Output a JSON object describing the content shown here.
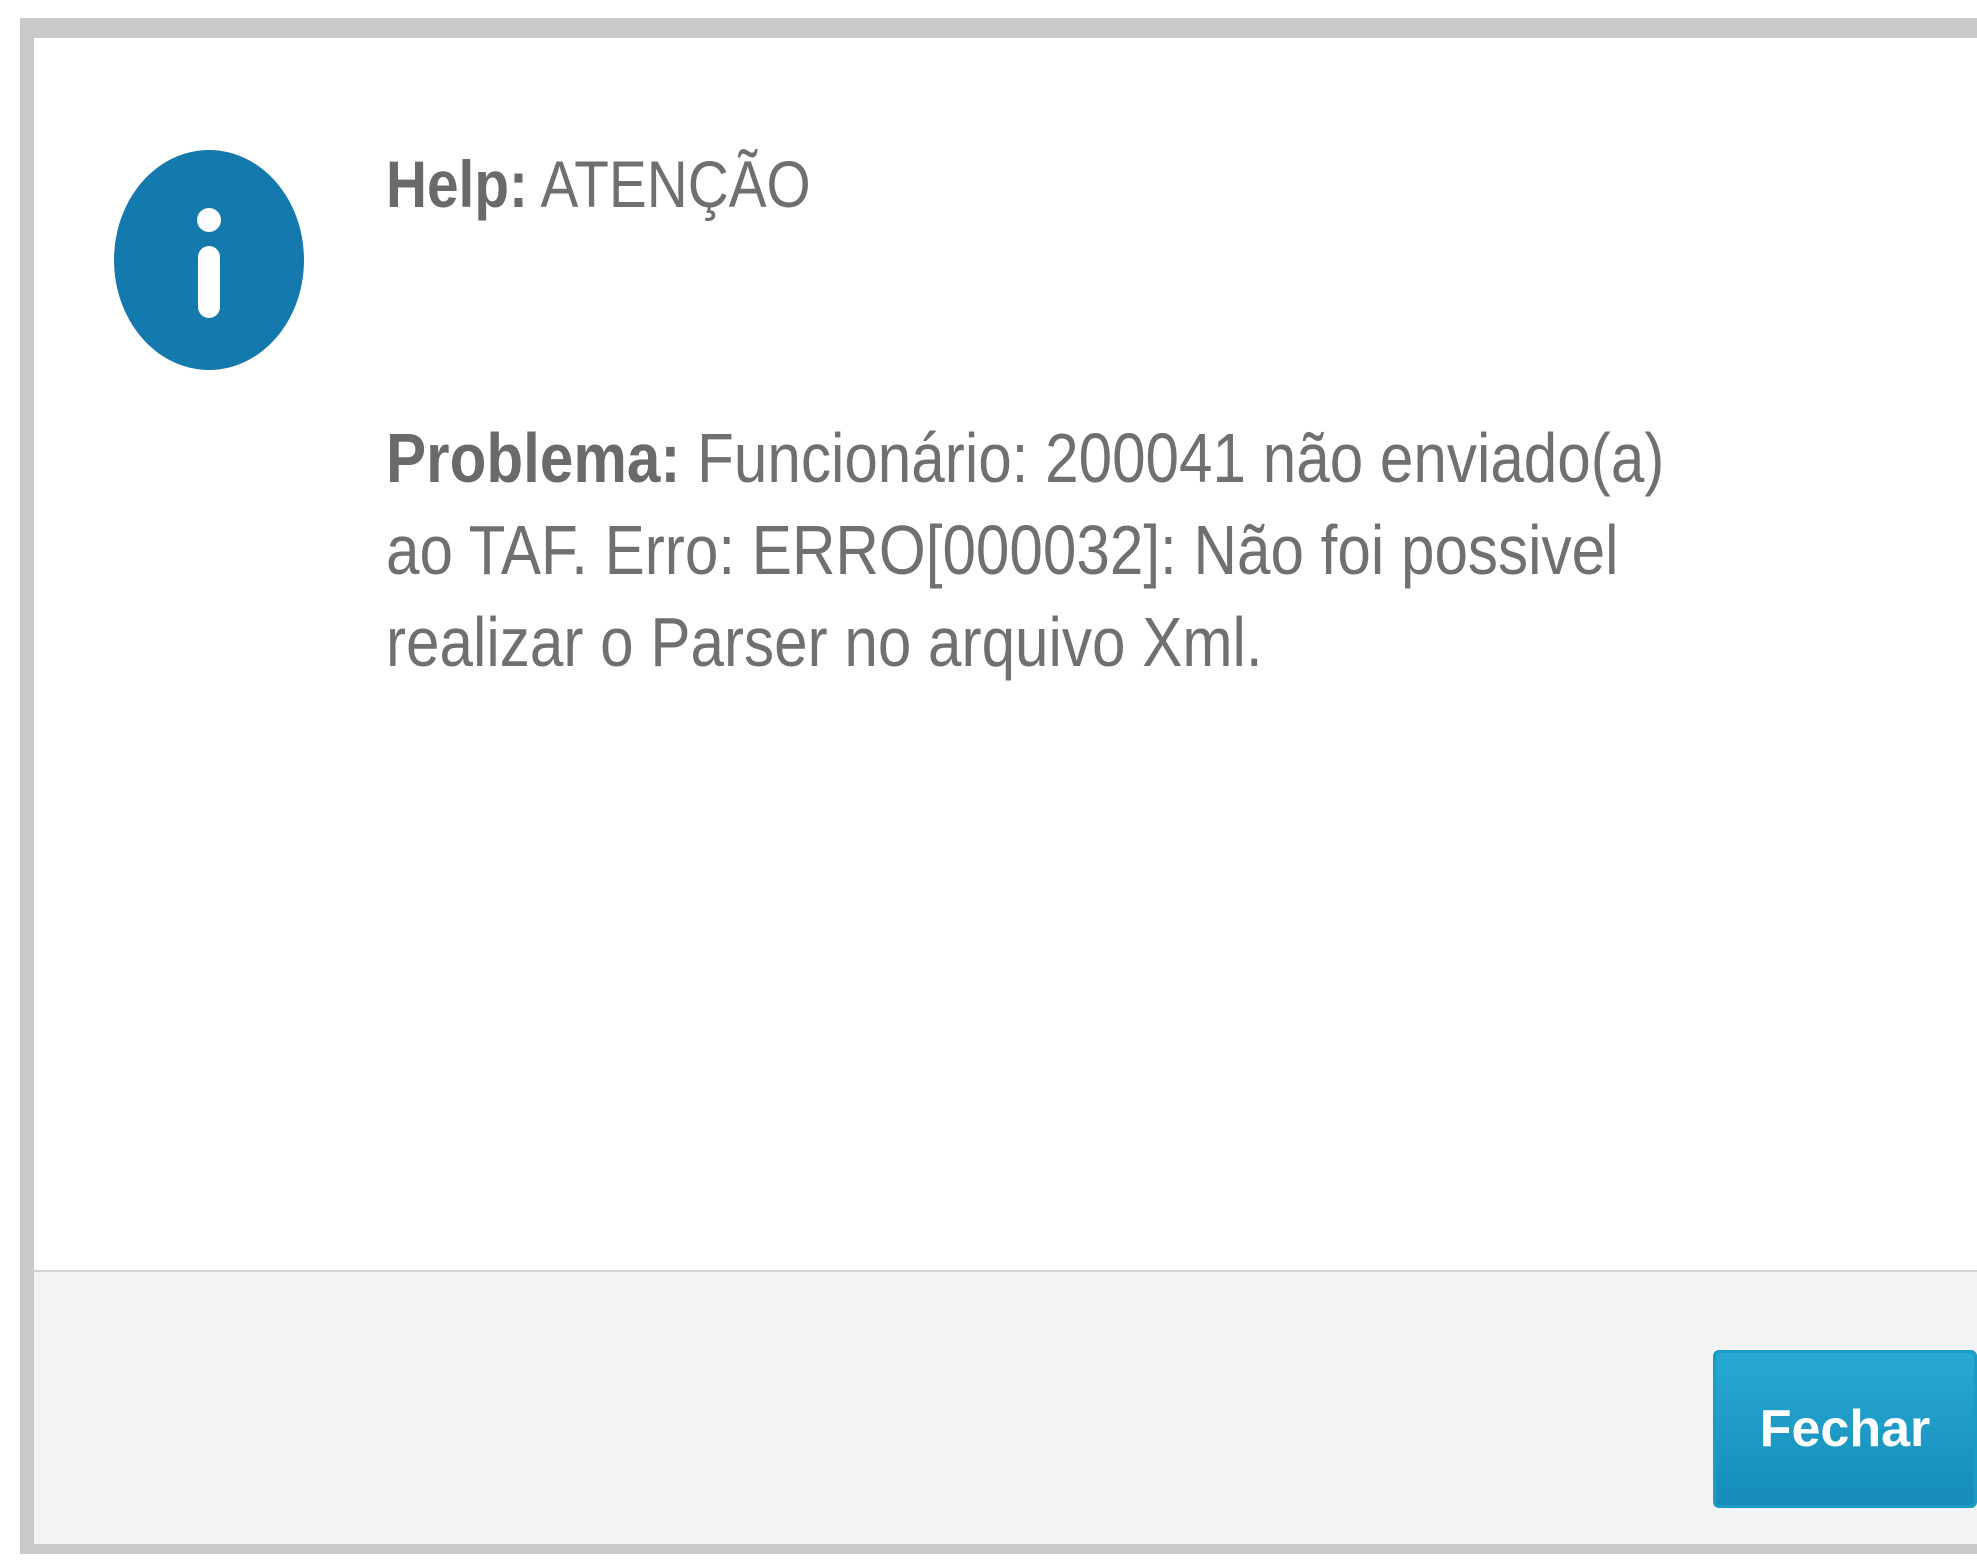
{
  "dialog": {
    "title_label": "Help:",
    "title_text": "ATENÇÃO",
    "message_label": "Problema:",
    "message_text": "Funcionário: 200041 não enviado(a) ao TAF. Erro: ERRO[000032]: Não foi possivel realizar o Parser no arquivo Xml.",
    "icon": "info-icon",
    "close_label": "Fechar"
  },
  "colors": {
    "icon_blue": "#1479ac",
    "button_blue": "#1e9cc9",
    "text_gray": "#707070",
    "border_gray": "#c9c9c9",
    "footer_bg": "#f4f4f4"
  }
}
